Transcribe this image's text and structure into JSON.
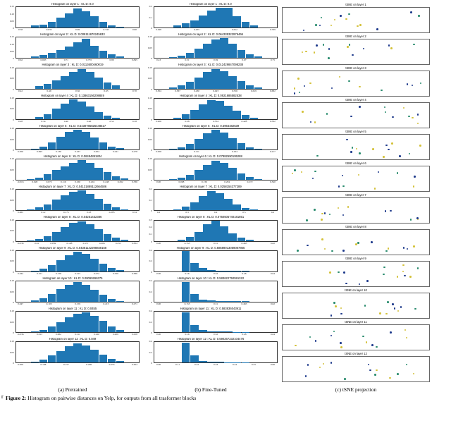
{
  "subcaptions": {
    "a": "(a) Pretrained",
    "b": "(b) Fine-Tuned",
    "c": "(c) tSNE projection"
  },
  "caption": {
    "lead": "Figure 2:",
    "rest": " Histogram on pairwise distances on Yelp, for outputs from all trasformer blocks"
  },
  "stray": "r",
  "chart_data": {
    "pretrained_histograms": [
      {
        "title": "Histogram on layer 1 : KL D: 0.0",
        "yticks": [
          "0.15",
          "0.10",
          "0.05",
          "0"
        ],
        "xticks": [
          "0.58",
          "0.635",
          "0.69",
          "0.745",
          "0.80"
        ],
        "bars": [
          0.1,
          0.15,
          0.3,
          0.48,
          0.7,
          0.95,
          0.8,
          0.55,
          0.3,
          0.12,
          0.05
        ]
      },
      {
        "title": "Histogram on layer 2 : KL D: 0.008111670245633",
        "yticks": [
          "0.15",
          "0.10",
          "0.05",
          "0"
        ],
        "xticks": [
          "0.62",
          "0.665",
          "0.71",
          "0.755",
          "0.80",
          "0.845"
        ],
        "bars": [
          0.08,
          0.15,
          0.25,
          0.4,
          0.58,
          0.78,
          0.95,
          0.6,
          0.35,
          0.18,
          0.08
        ]
      },
      {
        "title": "Histogram on layer 3 : KL D: 0.0113600460019",
        "yticks": [
          "0.10",
          "0.05",
          "0"
        ],
        "xticks": [
          "0.42",
          "0.49",
          "0.56",
          "0.63",
          "0.70"
        ],
        "bars": [
          0.12,
          0.22,
          0.4,
          0.6,
          0.82,
          0.95,
          0.8,
          0.55,
          0.3,
          0.15
        ]
      },
      {
        "title": "Histogram on layer 4 : KL D: 0.13863156208849",
        "yticks": [
          "0.10",
          "0.05",
          "0"
        ],
        "xticks": [
          "0.28",
          "0.34",
          "0.40",
          "0.46",
          "0.52",
          "0.58"
        ],
        "bars": [
          0.1,
          0.25,
          0.5,
          0.75,
          0.95,
          0.85,
          0.6,
          0.35,
          0.18,
          0.08
        ]
      },
      {
        "title": "Histogram on layer 5 : KL D: 0.5430785825448517",
        "yticks": [
          "0.10",
          "0.05",
          "0"
        ],
        "xticks": [
          "0.056",
          "0.093",
          "0.130",
          "0.167",
          "0.204",
          "0.241",
          "0.278"
        ],
        "bars": [
          0.05,
          0.15,
          0.35,
          0.62,
          0.88,
          0.98,
          0.85,
          0.6,
          0.35,
          0.15,
          0.06
        ]
      },
      {
        "title": "Histogram on layer 6 : KL D: 0.06494851804",
        "yticks": [
          "0.10",
          "0.05",
          "0"
        ],
        "xticks": [
          "-0.016",
          "0.028",
          "0.072",
          "0.116",
          "0.160",
          "0.204",
          "0.248",
          "0.292",
          "0.336"
        ],
        "bars": [
          0.04,
          0.12,
          0.28,
          0.48,
          0.68,
          0.85,
          0.96,
          0.82,
          0.6,
          0.38,
          0.18,
          0.08
        ]
      },
      {
        "title": "Histogram on layer 7 : KL D: 0.04131889112664506",
        "yticks": [
          "0.10",
          "0.05",
          "0"
        ],
        "xticks": [
          "0.065",
          "0.12",
          "0.175",
          "0.23",
          "0.285",
          "0.34"
        ],
        "bars": [
          0.05,
          0.14,
          0.3,
          0.52,
          0.74,
          0.92,
          0.98,
          0.8,
          0.55,
          0.32,
          0.14,
          0.05
        ]
      },
      {
        "title": "Histogram on layer 8 : KL D: 0.04251432386",
        "yticks": [
          "0.10",
          "0.05",
          "0"
        ],
        "xticks": [
          "-0.039",
          "0.01",
          "0.059",
          "0.108",
          "0.157",
          "0.206",
          "0.255",
          "0.304"
        ],
        "bars": [
          0.03,
          0.1,
          0.24,
          0.45,
          0.68,
          0.88,
          0.97,
          0.82,
          0.58,
          0.34,
          0.16,
          0.06
        ]
      },
      {
        "title": "Histogram on layer 9 : KL D: 0.04381142298848168",
        "yticks": [
          "0.10",
          "0.05",
          "0"
        ],
        "xticks": [
          "0.044",
          "0.101",
          "0.158",
          "0.215",
          "0.272",
          "0.329",
          "0.386"
        ],
        "bars": [
          0.04,
          0.14,
          0.32,
          0.56,
          0.8,
          0.96,
          0.85,
          0.6,
          0.36,
          0.16,
          0.06
        ]
      },
      {
        "title": "Histogram on layer 10 : KL D: 0.08069266375",
        "yticks": [
          "0.10",
          "0.05",
          "0"
        ],
        "xticks": [
          "0.047",
          "0.103",
          "0.159",
          "0.215",
          "0.271"
        ],
        "bars": [
          0.06,
          0.18,
          0.38,
          0.62,
          0.84,
          0.97,
          0.82,
          0.58,
          0.34,
          0.15,
          0.05
        ]
      },
      {
        "title": "Histogram on layer 11 : KL D: 0.0455",
        "yticks": [
          "0.10",
          "0.05",
          "0"
        ],
        "xticks": [
          "-0.036",
          "0.013",
          "0.062",
          "0.111",
          "0.160",
          "0.209",
          "0.258"
        ],
        "bars": [
          0.04,
          0.12,
          0.28,
          0.5,
          0.74,
          0.92,
          0.98,
          0.8,
          0.55,
          0.3,
          0.12
        ]
      },
      {
        "title": "Histogram on layer 12 : KL D: 0.049",
        "yticks": [
          "0.10",
          "0.05",
          "0"
        ],
        "xticks": [
          "0.059",
          "0.108",
          "0.157",
          "0.206",
          "0.255",
          "0.304"
        ],
        "bars": [
          0.05,
          0.16,
          0.35,
          0.58,
          0.8,
          0.96,
          0.85,
          0.62,
          0.38,
          0.18,
          0.07
        ]
      }
    ],
    "finetuned_histograms": [
      {
        "title": "Histogram on layer 1 : KL D: 0.0",
        "yticks": [
          "0.2",
          "0.1",
          "0"
        ],
        "xticks": [
          "0.298",
          "0.455",
          "0.612",
          "0.769"
        ],
        "bars": [
          0.1,
          0.2,
          0.35,
          0.58,
          0.82,
          0.98,
          0.96,
          0.55,
          0.28,
          0.12
        ]
      },
      {
        "title": "Histogram on layer 2 : KL D: 0.064335322976466",
        "yticks": [
          "0.10",
          "0.05",
          "0"
        ],
        "xticks": [
          "0.43",
          "0.51",
          "0.59",
          "0.67",
          "0.75"
        ],
        "bars": [
          0.05,
          0.12,
          0.25,
          0.45,
          0.7,
          0.92,
          0.98,
          0.7,
          0.4,
          0.18,
          0.07
        ]
      },
      {
        "title": "Histogram on layer 3 : KL D: 0.012429847098238",
        "yticks": [
          "0.10",
          "0.05",
          "0"
        ],
        "xticks": [
          "0.304",
          "0.367",
          "0.430",
          "0.493",
          "0.556",
          "0.619",
          "0.682"
        ],
        "bars": [
          0.06,
          0.15,
          0.32,
          0.55,
          0.8,
          0.96,
          0.85,
          0.6,
          0.35,
          0.15,
          0.06
        ]
      },
      {
        "title": "Histogram on layer 4 : KL D: 0.0921686582538",
        "yticks": [
          "0.10",
          "0.05",
          "0"
        ],
        "xticks": [
          "0.206",
          "0.28",
          "0.354",
          "0.428",
          "0.502"
        ],
        "bars": [
          0.08,
          0.22,
          0.45,
          0.72,
          0.94,
          0.9,
          0.65,
          0.4,
          0.2,
          0.08
        ]
      },
      {
        "title": "Histogram on layer 5 : KL D: 0.5964482639",
        "yticks": [
          "0.10",
          "0.05",
          "0"
        ],
        "xticks": [
          "0.058",
          "0.111",
          "0.164",
          "0.217"
        ],
        "bars": [
          0.04,
          0.12,
          0.28,
          0.52,
          0.78,
          0.96,
          0.82,
          0.55,
          0.3,
          0.12,
          0.04
        ]
      },
      {
        "title": "Histogram on layer 6 : KL D: 0.07882590195288",
        "yticks": [
          "0.10",
          "0.05",
          "0"
        ],
        "xticks": [
          "0.00",
          "0.068",
          "0.136",
          "0.204",
          "0.272",
          "0.340"
        ],
        "bars": [
          0.03,
          0.1,
          0.24,
          0.48,
          0.74,
          0.94,
          0.85,
          0.58,
          0.32,
          0.14,
          0.05
        ]
      },
      {
        "title": "Histogram on layer 7 : KL D: 0.0258154377289",
        "yticks": [
          "0.2",
          "0.1",
          "0"
        ],
        "xticks": [
          "0.2",
          "0.3",
          "0.4",
          "0.5",
          "0.6"
        ],
        "bars": [
          0.06,
          0.18,
          0.4,
          0.7,
          0.95,
          0.85,
          0.55,
          0.28,
          0.12,
          0.05
        ]
      },
      {
        "title": "Histogram on layer 8 : KL D: 0.0750505740181851",
        "yticks": [
          "0.3",
          "0.2",
          "0.1",
          "0"
        ],
        "xticks": [
          "0.00",
          "0.155",
          "0.31",
          "0.465",
          "0.62"
        ],
        "bars": [
          0.05,
          0.18,
          0.45,
          0.82,
          0.98,
          0.7,
          0.38,
          0.15,
          0.06
        ]
      },
      {
        "title": "Histogram on layer 9 : KL D: 0.58589013059087865",
        "yticks": [
          "0.4",
          "0.2",
          "0"
        ],
        "xticks": [
          "0.00",
          "0.16",
          "0.32",
          "0.48",
          "0.64"
        ],
        "bars": [
          0.98,
          0.4,
          0.15,
          0.08,
          0.04,
          0.03,
          0.02,
          0.02
        ]
      },
      {
        "title": "Histogram on layer 10 : KL D: 0.583622750591322",
        "yticks": [
          "0.4",
          "0.2",
          "0"
        ],
        "xticks": [
          "0.00",
          "0.155",
          "0.31",
          "0.465",
          "0.62"
        ],
        "bars": [
          0.98,
          0.38,
          0.12,
          0.06,
          0.04,
          0.03,
          0.02,
          0.02
        ]
      },
      {
        "title": "Histogram on layer 11 : KL D: 0.583836043911",
        "yticks": [
          "0.4",
          "0.2",
          "0"
        ],
        "xticks": [
          "0.00",
          "0.16",
          "0.32",
          "0.48",
          "0.64"
        ],
        "bars": [
          0.98,
          0.36,
          0.1,
          0.05,
          0.04,
          0.03,
          0.02,
          0.02
        ]
      },
      {
        "title": "Histogram on layer 12 : KL D: 0.590267232104476",
        "yticks": [
          "0.4",
          "0.2",
          "0"
        ],
        "xticks": [
          "0.00",
          "0.11",
          "0.22",
          "0.33",
          "0.44",
          "0.55",
          "0.66"
        ],
        "bars": [
          0.98,
          0.35,
          0.1,
          0.05,
          0.04,
          0.03,
          0.02,
          0.02
        ]
      }
    ],
    "tsne": {
      "layers": [
        1,
        2,
        3,
        4,
        5,
        6,
        7,
        8,
        9,
        10,
        11,
        12
      ],
      "title_prefix": "tSNE on layer ",
      "palette": [
        "#1f3b8c",
        "#d4c23a",
        "#2a8c6e",
        "#1f3b8c",
        "#d4c23a",
        "#2a8c6e",
        "#1f3b8c",
        "#d4c23a",
        "#2a8c6e",
        "#1f3b8c",
        "#d4c23a",
        "#2a8c6e"
      ],
      "points_per_layer": 14
    }
  }
}
